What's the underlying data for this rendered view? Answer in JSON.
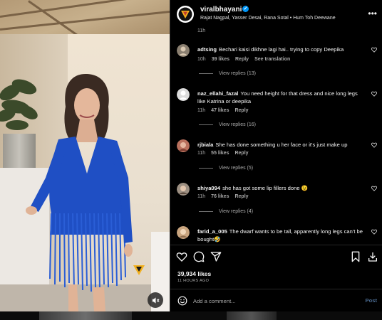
{
  "post": {
    "username": "viralbhayani",
    "verified_mark": "✓",
    "subline": "Rajat Nagpal, Yasser Desai, Rana Sotal • Hum Toh Deewane",
    "more_icon": "•••",
    "prev_comment_time": "11h"
  },
  "comments": [
    {
      "user": "adtsing",
      "text": "Bechari kaisi dikhne lagi hai.. trying to copy Deepika",
      "time": "10h",
      "likes": "39 likes",
      "reply": "Reply",
      "translation": "See translation",
      "view_replies": "View replies (13)",
      "avatar_color": "#8a7f70"
    },
    {
      "user": "naz_ellahi_fazal",
      "text": "You need height for that dress and nice long legs like Katrina or deepika",
      "time": "11h",
      "likes": "47 likes",
      "reply": "Reply",
      "view_replies": "View replies (16)",
      "avatar_color": "#dcdcdc"
    },
    {
      "user": "rjbiala",
      "text": "She has done something u her face or it's just make up",
      "time": "11h",
      "likes": "55 likes",
      "reply": "Reply",
      "view_replies": "View replies (5)",
      "avatar_color": "#b9705d"
    },
    {
      "user": "shiya094",
      "text": "she has got some lip fillers done 😉",
      "time": "11h",
      "likes": "76 likes",
      "reply": "Reply",
      "view_replies": "View replies (4)",
      "avatar_color": "#9c8f82"
    },
    {
      "user": "farid_a_005",
      "text": "The dwarf wants to be tall, apparently long legs can't be bought🤣",
      "avatar_color": "#c9a57f"
    }
  ],
  "actions": {
    "like_icon": "heart-icon",
    "comment_icon": "comment-icon",
    "share_icon": "share-icon",
    "save_icon": "bookmark-icon",
    "download_icon": "download-icon"
  },
  "stats": {
    "likes": "39,934 likes",
    "time": "11 HOURS AGO"
  },
  "composer": {
    "placeholder": "Add a comment...",
    "post_label": "Post"
  },
  "colors": {
    "background": "#000000",
    "dress_blue": "#1f4fc4",
    "muted_text": "#a8a8a8",
    "verified_blue": "#0095f6"
  }
}
